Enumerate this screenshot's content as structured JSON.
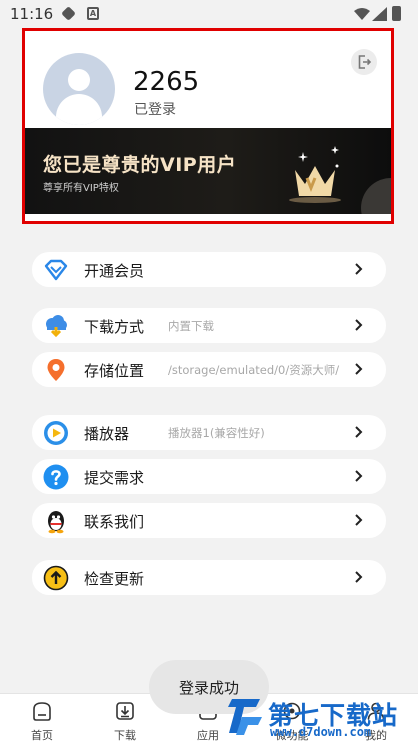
{
  "status_bar": {
    "time": "11:16",
    "icons": [
      "shield-icon",
      "a-icon",
      "wifi-icon",
      "signal-icon",
      "battery-icon"
    ]
  },
  "profile": {
    "user_name": "2265",
    "login_status": "已登录",
    "vip_title": "您已是尊贵的VIP用户",
    "vip_subtitle": "尊享所有VIP特权"
  },
  "menu": [
    {
      "id": "vip",
      "label": "开通会员",
      "value": "",
      "icon": "diamond-icon"
    },
    {
      "id": "download",
      "label": "下载方式",
      "value": "内置下载",
      "icon": "cloud-download-icon"
    },
    {
      "id": "storage",
      "label": "存储位置",
      "value": "/storage/emulated/0/资源大师/",
      "icon": "location-pin-icon"
    },
    {
      "id": "player",
      "label": "播放器",
      "value": "播放器1(兼容性好)",
      "icon": "play-icon"
    },
    {
      "id": "feedback",
      "label": "提交需求",
      "value": "",
      "icon": "question-icon"
    },
    {
      "id": "contact",
      "label": "联系我们",
      "value": "",
      "icon": "qq-penguin-icon"
    },
    {
      "id": "update",
      "label": "检查更新",
      "value": "",
      "icon": "upload-arrow-icon"
    }
  ],
  "toast": "登录成功",
  "bottom_nav": [
    {
      "label": "首页",
      "icon": "home-icon"
    },
    {
      "label": "下载",
      "icon": "download-icon"
    },
    {
      "label": "应用",
      "icon": "apps-icon"
    },
    {
      "label": "微功能",
      "icon": "tools-icon"
    },
    {
      "label": "我的",
      "icon": "user-icon"
    }
  ],
  "watermark": {
    "name": "第七下载站",
    "url": "www.d7down.com"
  },
  "colors": {
    "highlight_border": "#e00000",
    "vip_gold": "#f6e3c6",
    "watermark_blue": "#1769c9"
  }
}
